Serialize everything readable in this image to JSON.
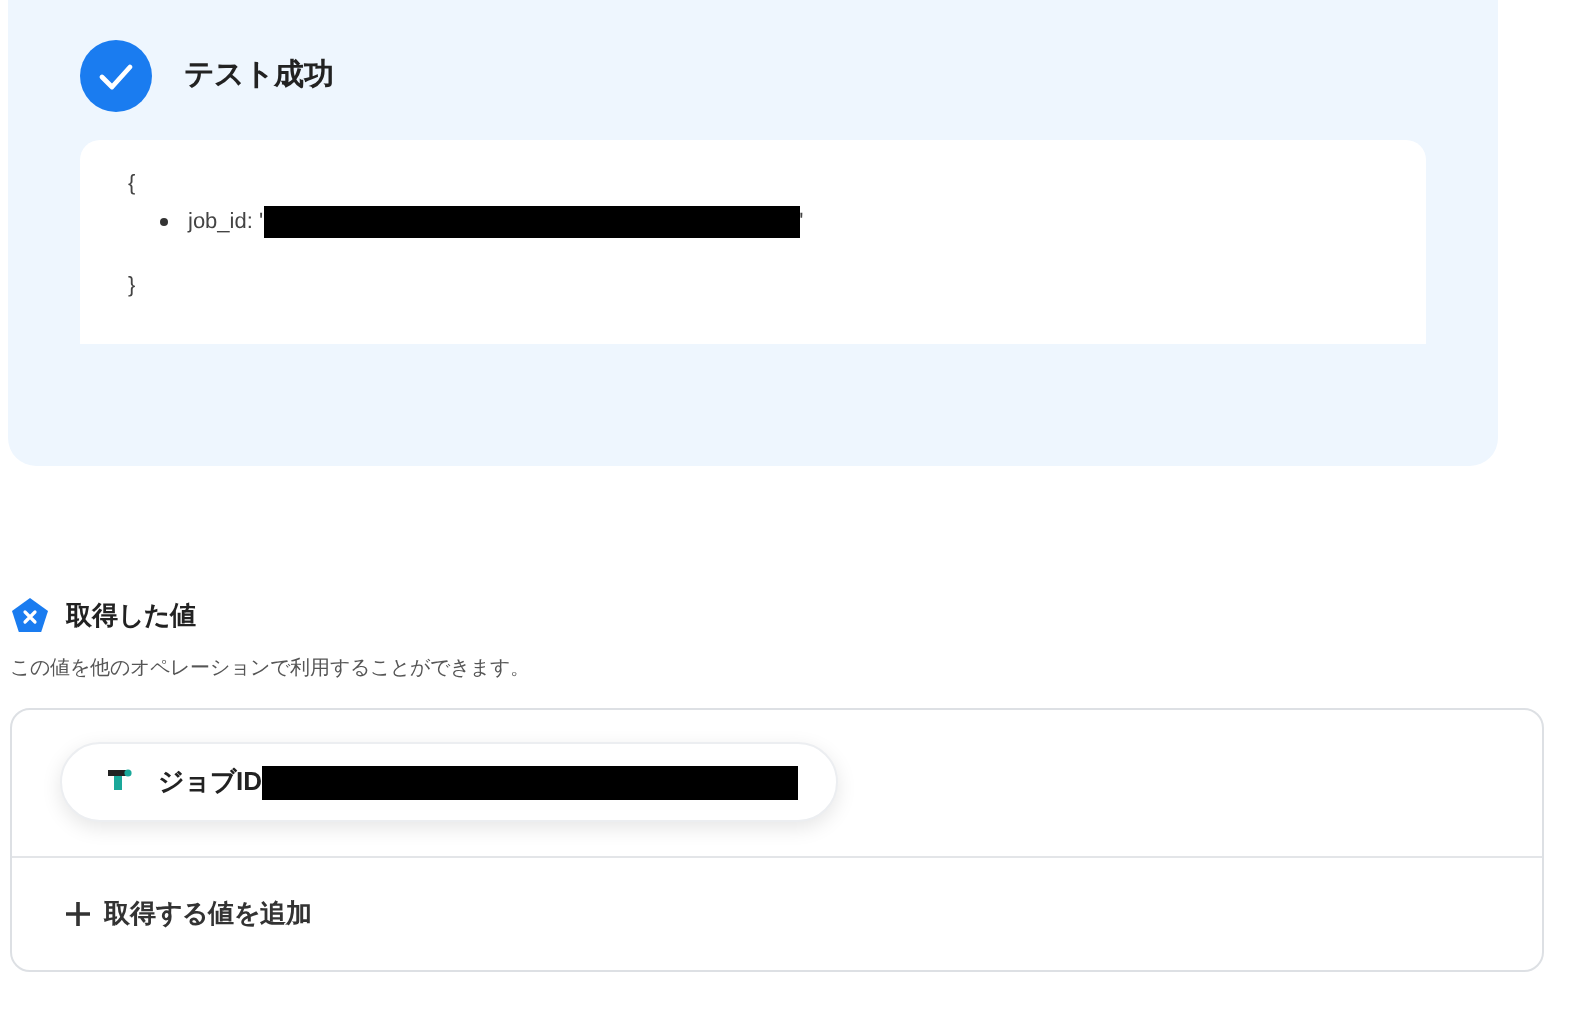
{
  "test_result": {
    "title": "テスト成功",
    "code": {
      "open": "{",
      "items": [
        {
          "key": "job_id: '",
          "close": "'"
        }
      ],
      "close": "}"
    }
  },
  "section": {
    "title": "取得した値",
    "description": "この値を他のオペレーションで利用することができます。",
    "values": [
      {
        "label": "ジョブID"
      }
    ],
    "add_button": "取得する値を追加"
  }
}
